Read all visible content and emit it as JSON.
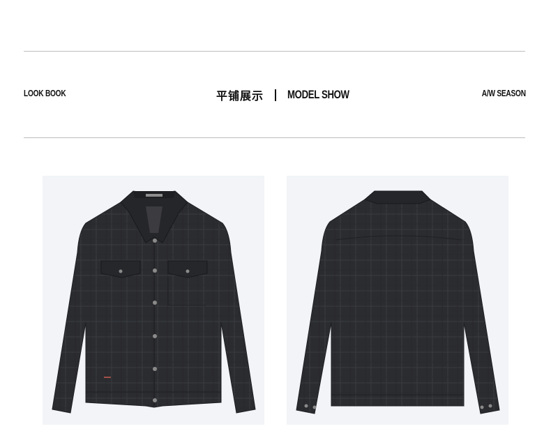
{
  "header": {
    "left_label": "LOOK BOOK",
    "cn_title": "平铺展示",
    "en_title": "MODEL SHOW",
    "right_label": "A/W SEASON"
  },
  "images": [
    {
      "name": "jacket-front-image",
      "icon": "jacket-front"
    },
    {
      "name": "jacket-back-image",
      "icon": "jacket-back"
    }
  ],
  "colors": {
    "rule": "#bdbdbd",
    "text": "#111111",
    "photo_bg": "#f2f4f7",
    "fabric": "#2b2c30",
    "fabric_dark": "#1f2023"
  }
}
